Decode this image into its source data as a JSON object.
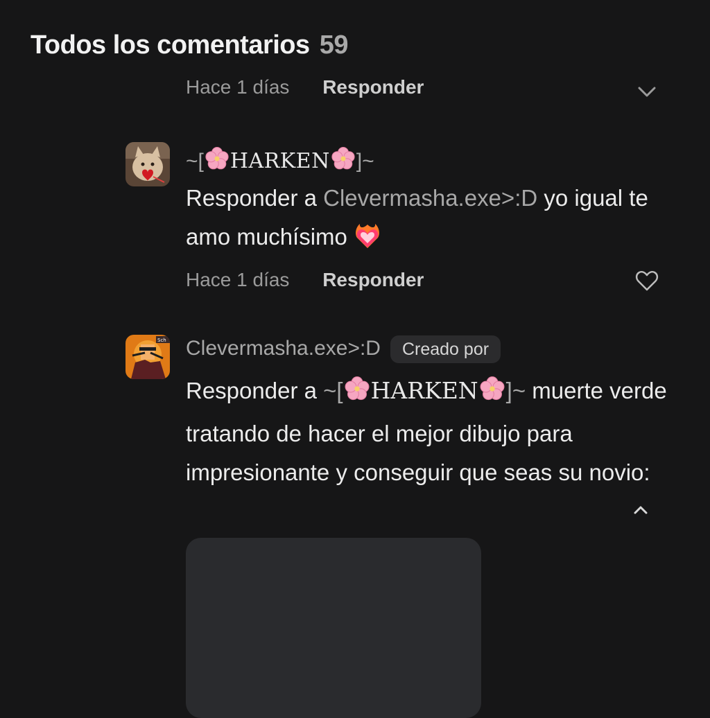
{
  "header": {
    "title": "Todos los comentarios",
    "count": "59"
  },
  "clipped_comment": {
    "time": "Hace 1 días",
    "reply_label": "Responder"
  },
  "comments": [
    {
      "username_prefix": "~[",
      "username_name": "HARKEN",
      "username_suffix": "]~",
      "reply_prefix": "Responder a ",
      "mention": "Clevermasha.exe>:D",
      "text": " yo igual te amo muchísimo ",
      "emoji": "heart-on-fire",
      "time": "Hace 1 días",
      "reply_label": "Responder"
    },
    {
      "username": "Clevermasha.exe>:D",
      "badge": "Creado por",
      "reply_prefix": "Responder a ",
      "mention_prefix": "~[",
      "mention_name": "HARKEN",
      "mention_suffix": "]~",
      "text": " muerte verde tratando de hacer el mejor dibujo para impresionante y conseguir que seas su novio:"
    }
  ],
  "colors": {
    "background": "#161617",
    "muted": "#a8a8a8",
    "badge_bg": "#2b2b2d",
    "image_placeholder": "#2a2b2e"
  }
}
